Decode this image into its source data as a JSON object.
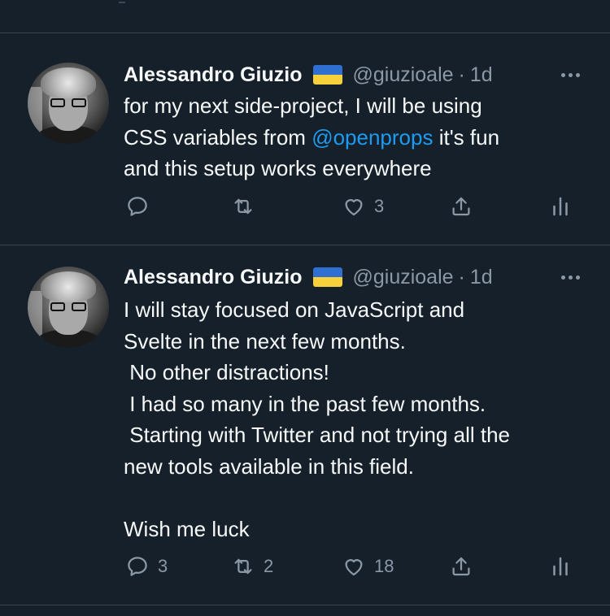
{
  "tweets": [
    {
      "author": {
        "name": "Alessandro Giuzio",
        "handle": "@giuzioale",
        "time": "1d"
      },
      "text_before": "for my next side-project, I will be using\nCSS variables from ",
      "mention": "@openprops",
      "text_after": " it's fun\nand this setup works everywhere",
      "actions": {
        "reply_count": "",
        "retweet_count": "",
        "like_count": "3"
      }
    },
    {
      "author": {
        "name": "Alessandro Giuzio",
        "handle": "@giuzioale",
        "time": "1d"
      },
      "text": "I will stay focused on JavaScript and\nSvelte in the next few months.\n No other distractions!\n I had so many in the past few months.\n Starting with Twitter and not trying all the\nnew tools available in this field.\n\nWish me luck",
      "actions": {
        "reply_count": "3",
        "retweet_count": "2",
        "like_count": "18"
      }
    }
  ],
  "separator": "·",
  "colors": {
    "background": "#15202b",
    "text": "#f7f9f9",
    "muted": "#8b98a5",
    "link": "#1d9bf0",
    "divider": "#38444d"
  },
  "icons": [
    "reply-icon",
    "retweet-icon",
    "like-icon",
    "share-icon",
    "analytics-icon",
    "more-icon",
    "ukraine-flag-icon"
  ]
}
